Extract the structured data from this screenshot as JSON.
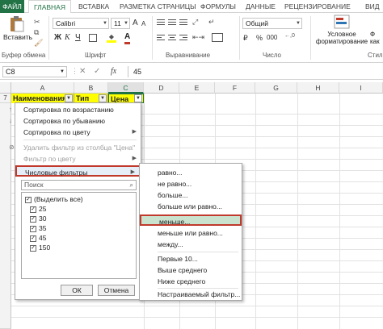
{
  "ribbon": {
    "tabs": [
      "ФАЙЛ",
      "ГЛАВНАЯ",
      "ВСТАВКА",
      "РАЗМЕТКА СТРАНИЦЫ",
      "ФОРМУЛЫ",
      "ДАННЫЕ",
      "РЕЦЕНЗИРОВАНИЕ",
      "ВИД"
    ],
    "active_tab": "ГЛАВНАЯ",
    "paste_label": "Вставить",
    "font_name": "Calibri",
    "font_size": "11",
    "bold": "Ж",
    "italic": "К",
    "underline": "Ч",
    "font_grow": "A",
    "font_shrink": "A",
    "font_color": "A",
    "number_format": "Общий",
    "currency": "₽",
    "percent": "%",
    "thousands": "000",
    "cond_format_line1": "Условное",
    "cond_format_line2": "форматирование",
    "styles_partial": "Ф",
    "styles_partial2": "как",
    "group_clipboard": "Буфер обмена",
    "group_font": "Шрифт",
    "group_alignment": "Выравнивание",
    "group_number": "Число",
    "group_styles": "Стили"
  },
  "formula_bar": {
    "name_box": "C8",
    "cancel": "✕",
    "enter": "✓",
    "fx": "fx",
    "value": "45"
  },
  "grid": {
    "columns": [
      "A",
      "B",
      "C",
      "D",
      "E",
      "F",
      "G",
      "H",
      "I"
    ],
    "selected_column": "C",
    "first_row": "7",
    "header_cells": [
      "Наименования",
      "Тип",
      "Цена"
    ],
    "header_fill": "#ffff00"
  },
  "filter_panel": {
    "items": [
      {
        "label": "Сортировка по возрастанию",
        "disabled": false
      },
      {
        "label": "Сортировка по убыванию",
        "disabled": false
      },
      {
        "label": "Сортировка по цвету",
        "disabled": false
      },
      {
        "label": "Удалить фильтр из столбца \"Цена\"",
        "disabled": true
      },
      {
        "label": "Фильтр по цвету",
        "disabled": true
      },
      {
        "label": "Числовые фильтры",
        "disabled": false
      }
    ],
    "search_placeholder": "Поиск",
    "values": [
      "(Выделить все)",
      "25",
      "30",
      "35",
      "45",
      "150"
    ],
    "ok": "ОК",
    "cancel": "Отмена"
  },
  "submenu": {
    "items": [
      "равно...",
      "не равно...",
      "больше...",
      "больше или равно...",
      "меньше...",
      "меньше или равно...",
      "между...",
      "Первые 10...",
      "Выше среднего",
      "Ниже среднего",
      "Настраиваемый фильтр..."
    ],
    "highlighted": "меньше...",
    "highlight_color": "#c0392b"
  }
}
